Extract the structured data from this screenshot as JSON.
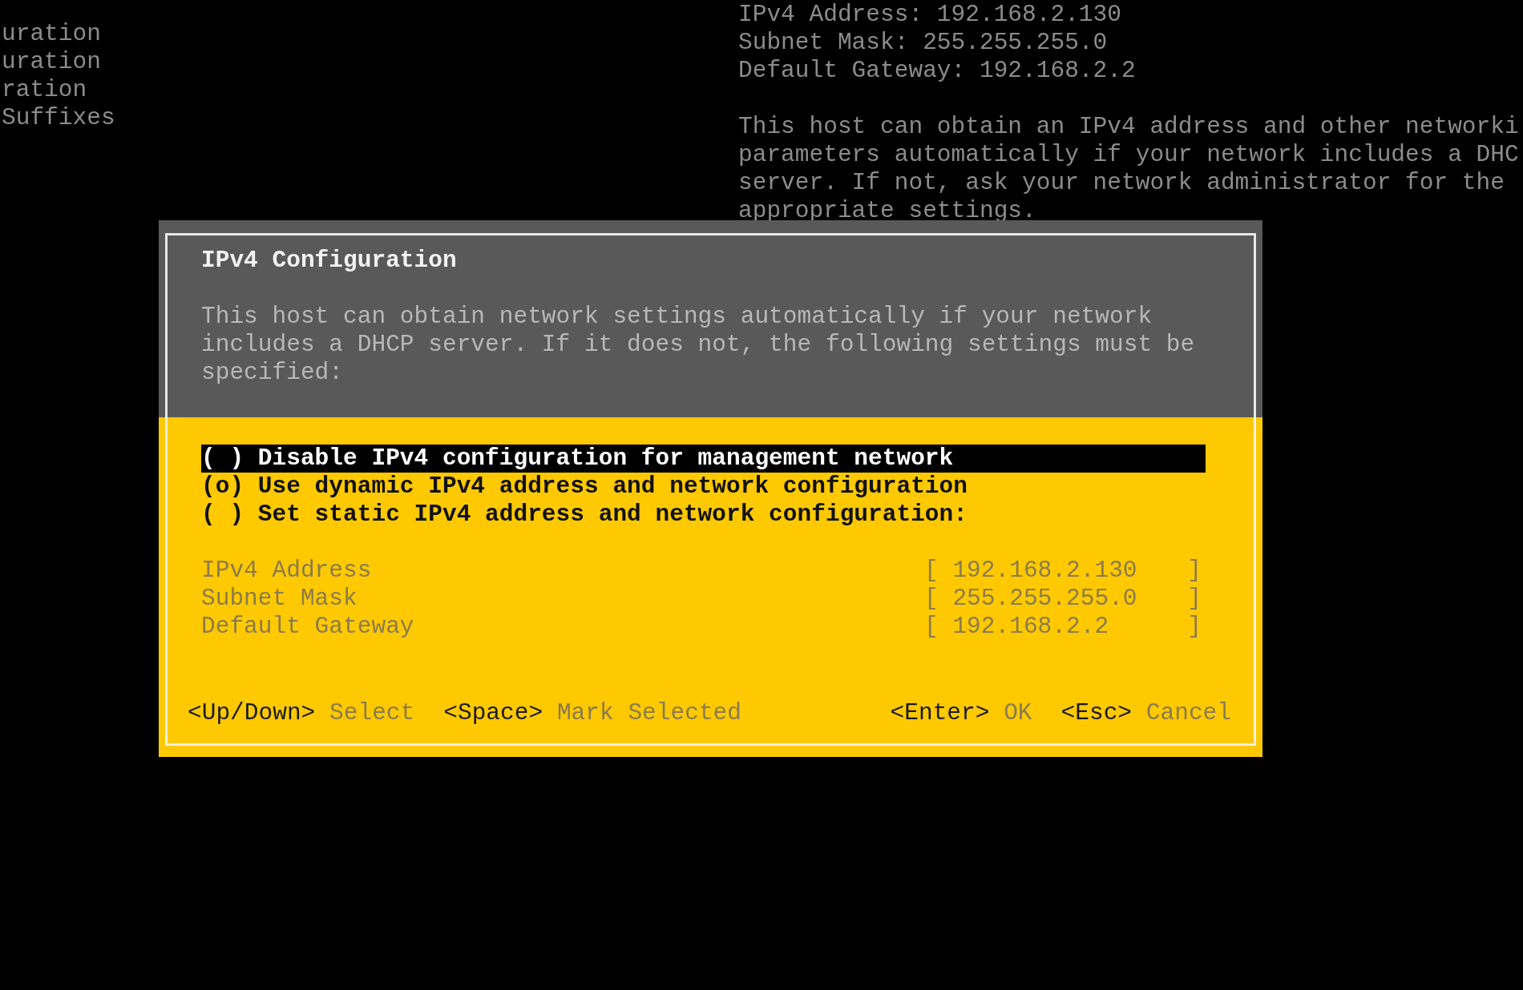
{
  "background": {
    "left_lines": [
      "uration",
      "uration",
      "ration",
      "Suffixes"
    ],
    "status_lines": [
      "IPv4 Address: 192.168.2.130",
      "Subnet Mask: 255.255.255.0",
      "Default Gateway: 192.168.2.2"
    ],
    "paragraph_lines": [
      "This host can obtain an IPv4 address and other networki",
      "parameters automatically if your network includes a DHC",
      "server. If not, ask your network administrator for the",
      "appropriate settings."
    ]
  },
  "dialog": {
    "title": "IPv4 Configuration",
    "description": [
      "This host can obtain network settings automatically if your network",
      "includes a DHCP server. If it does not, the following settings must be",
      "specified:"
    ],
    "options": [
      {
        "radio": "( )",
        "label": "Disable IPv4 configuration for management network",
        "selected": true
      },
      {
        "radio": "(o)",
        "label": "Use dynamic IPv4 address and network configuration",
        "selected": false
      },
      {
        "radio": "( )",
        "label": "Set static IPv4 address and network configuration:",
        "selected": false
      }
    ],
    "field_brackets": [
      "[",
      "]"
    ],
    "fields": [
      {
        "label": "IPv4 Address",
        "value": "192.168.2.130"
      },
      {
        "label": "Subnet Mask",
        "value": "255.255.255.0"
      },
      {
        "label": "Default Gateway",
        "value": "192.168.2.2"
      }
    ],
    "footer_left": [
      {
        "key": "<Up/Down>",
        "action": "Select"
      },
      {
        "key": "<Space>",
        "action": "Mark Selected"
      }
    ],
    "footer_right": [
      {
        "key": "<Enter>",
        "action": "OK"
      },
      {
        "key": "<Esc>",
        "action": "Cancel"
      }
    ]
  }
}
